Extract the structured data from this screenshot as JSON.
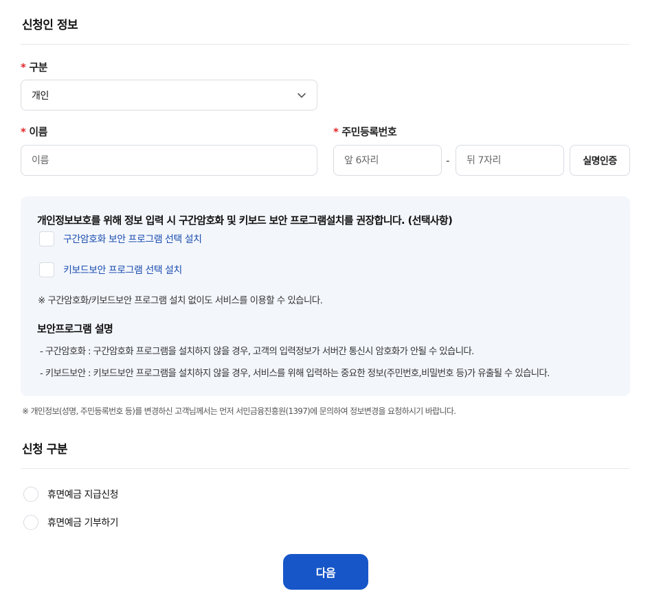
{
  "applicant_section": {
    "title": "신청인 정보"
  },
  "type_field": {
    "required_mark": "*",
    "label": "구분",
    "selected": "개인"
  },
  "name_field": {
    "required_mark": "*",
    "label": "이름",
    "placeholder": "이름"
  },
  "rrn_field": {
    "required_mark": "*",
    "label": "주민등록번호",
    "front_placeholder": "앞 6자리",
    "separator": "-",
    "back_placeholder": "뒤 7자리",
    "verify_button": "실명인증"
  },
  "security_panel": {
    "heading": "개인정보보호를 위해 정보 입력 시 구간암호화 및 키보드 보안 프로그램설치를 권장합니다. (선택사항)",
    "options": [
      {
        "label": "구간암호화 보안 프로그램 선택 설치",
        "checked": false
      },
      {
        "label": "키보드보안 프로그램 선택 설치",
        "checked": false
      }
    ],
    "note": "※ 구간암호화/키보드보안 프로그램 설치 없이도 서비스를 이용할 수 있습니다.",
    "desc_title": "보안프로그램 설명",
    "descriptions": [
      "- 구간암호화 : 구간암호화 프로그램을 설치하지 않을 경우, 고객의 입력정보가 서버간 통신시 암호화가 안될 수 있습니다.",
      "- 키보드보안 : 키보드보안 프로그램을 설치하지 않을 경우, 서비스를 위해 입력하는 중요한 정보(주민번호,비밀번호 등)가 유출될 수 있습니다."
    ]
  },
  "footnote": "※ 개인정보(성명, 주민등록번호 등)를 변경하신 고객님께서는 먼저 서민금융진흥원(1397)에 문의하여 정보변경을 요청하시기 바랍니다.",
  "request_section": {
    "title": "신청 구분",
    "options": [
      {
        "label": "휴면예금 지급신청",
        "selected": false
      },
      {
        "label": "휴면예금 기부하기",
        "selected": false
      }
    ]
  },
  "next_button": "다음",
  "colors": {
    "primary": "#1656c8",
    "required": "#e2262a",
    "link_text": "#1d4fb0",
    "panel_bg": "#f3f6fb",
    "border": "#d8dbe0"
  },
  "icons": {
    "select_toggle": "chevron-down-icon"
  }
}
